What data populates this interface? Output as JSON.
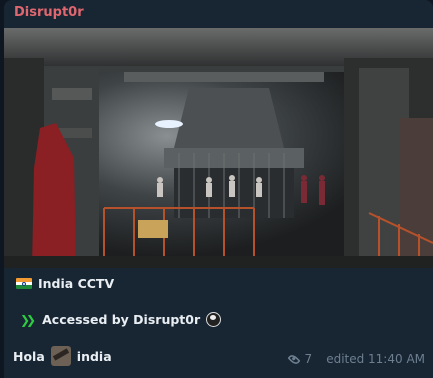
{
  "message": {
    "sender": "Disrupt0r",
    "photo_description_icon": "cctv-photo",
    "line1": {
      "icon": "india-flag-icon",
      "text": "India CCTV"
    },
    "line2": {
      "icon": "double-chevron-icon",
      "text": "Accessed by Disrupt0r",
      "trailing_icon": "globe-icon"
    },
    "line3": {
      "prefix": "Hola",
      "sticker": "sticker-icon",
      "suffix": "india"
    },
    "views": "7",
    "status": "edited 11:40 AM"
  },
  "colors": {
    "background": "#0e1621",
    "bubble": "#182533",
    "sender": "#e0676f",
    "text": "#e9eef3",
    "meta": "#6d7f8f"
  }
}
